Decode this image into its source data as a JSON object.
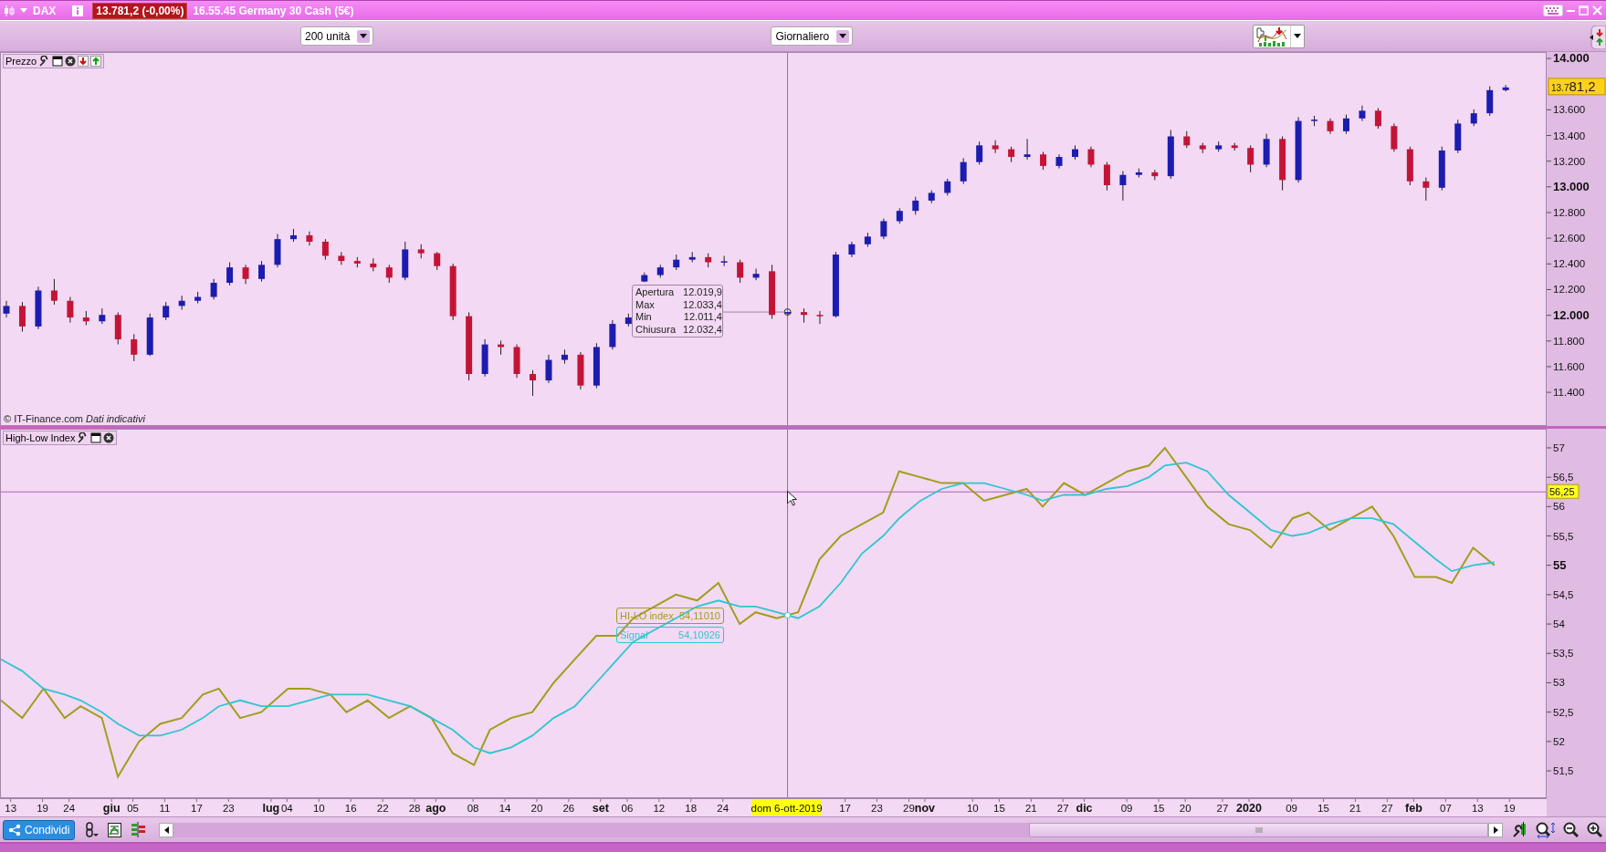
{
  "window": {
    "symbol": "DAX",
    "price": "13.781,2 (-0,00%)",
    "title": "16.55.45 Germany 30 Cash (5€)"
  },
  "toolbar": {
    "units": "200 unità",
    "period": "Giornaliero"
  },
  "price_pane": {
    "title": "Prezzo",
    "tooltip": [
      {
        "label": "Apertura",
        "value": "12.019,9"
      },
      {
        "label": "Max",
        "value": "12.033,4"
      },
      {
        "label": "Min",
        "value": "12.011,4"
      },
      {
        "label": "Chiusura",
        "value": "12.032,4"
      }
    ],
    "credit": "© IT-Finance.com *Dati indicativi*",
    "chart_data": {
      "type": "candlestick",
      "categories": [
        null,
        null,
        null,
        null,
        null,
        null,
        null,
        null,
        null,
        null,
        null,
        null,
        null,
        null,
        null,
        null,
        null,
        null,
        null,
        null,
        null,
        null,
        null,
        null,
        null,
        null,
        null,
        null,
        null,
        null,
        null,
        null,
        null,
        null,
        null,
        null,
        null,
        null,
        null,
        null,
        null,
        null,
        null,
        null,
        null,
        null,
        null,
        null,
        null,
        null,
        null,
        null,
        null,
        null,
        null,
        null,
        null,
        null,
        null,
        null,
        null,
        null,
        null,
        null,
        null,
        null,
        null,
        null,
        null,
        null,
        null,
        null,
        null,
        null,
        null,
        null,
        null,
        null,
        null,
        null,
        null,
        null,
        null,
        null,
        null,
        null,
        null,
        null,
        null,
        null,
        null,
        null,
        null,
        null,
        null
      ],
      "ohlc": [
        [
          12020,
          12120,
          11990,
          12080
        ],
        [
          12080,
          12110,
          11880,
          11920
        ],
        [
          11920,
          12230,
          11900,
          12200
        ],
        [
          12200,
          12290,
          12090,
          12120
        ],
        [
          12120,
          12150,
          11950,
          11990
        ],
        [
          11990,
          12040,
          11930,
          11960
        ],
        [
          11960,
          12060,
          11940,
          12010
        ],
        [
          12010,
          12030,
          11780,
          11820
        ],
        [
          11820,
          11860,
          11650,
          11700
        ],
        [
          11700,
          12020,
          11690,
          11990
        ],
        [
          11990,
          12110,
          11970,
          12080
        ],
        [
          12080,
          12160,
          12050,
          12120
        ],
        [
          12120,
          12190,
          12100,
          12150
        ],
        [
          12150,
          12290,
          12130,
          12260
        ],
        [
          12260,
          12420,
          12240,
          12380
        ],
        [
          12380,
          12400,
          12250,
          12290
        ],
        [
          12290,
          12430,
          12270,
          12400
        ],
        [
          12400,
          12640,
          12380,
          12600
        ],
        [
          12600,
          12680,
          12580,
          12630
        ],
        [
          12630,
          12660,
          12550,
          12580
        ],
        [
          12580,
          12600,
          12440,
          12470
        ],
        [
          12470,
          12500,
          12400,
          12430
        ],
        [
          12430,
          12460,
          12380,
          12410
        ],
        [
          12410,
          12450,
          12350,
          12380
        ],
        [
          12380,
          12400,
          12260,
          12300
        ],
        [
          12300,
          12580,
          12280,
          12520
        ],
        [
          12520,
          12560,
          12450,
          12490
        ],
        [
          12490,
          12500,
          12360,
          12390
        ],
        [
          12390,
          12410,
          11970,
          12000
        ],
        [
          12000,
          12030,
          11500,
          11550
        ],
        [
          11550,
          11820,
          11530,
          11780
        ],
        [
          11780,
          11810,
          11700,
          11760
        ],
        [
          11760,
          11780,
          11520,
          11550
        ],
        [
          11550,
          11580,
          11380,
          11500
        ],
        [
          11500,
          11700,
          11480,
          11660
        ],
        [
          11660,
          11740,
          11630,
          11700
        ],
        [
          11700,
          11720,
          11430,
          11460
        ],
        [
          11460,
          11790,
          11440,
          11760
        ],
        [
          11760,
          11970,
          11740,
          11940
        ],
        [
          11940,
          12020,
          11920,
          11990
        ],
        [
          12270,
          12340,
          12265,
          12320
        ],
        [
          12320,
          12400,
          12300,
          12380
        ],
        [
          12380,
          12480,
          12360,
          12440
        ],
        [
          12440,
          12500,
          12420,
          12460
        ],
        [
          12460,
          12490,
          12380,
          12420
        ],
        [
          12420,
          12470,
          12390,
          12425
        ],
        [
          12420,
          12440,
          12260,
          12300
        ],
        [
          12300,
          12370,
          12280,
          12330
        ],
        [
          12350,
          12400,
          11980,
          12010
        ],
        [
          12019.9,
          12033.4,
          12011.4,
          12032.4
        ],
        [
          12032,
          12060,
          11950,
          12010
        ],
        [
          12010,
          12040,
          11940,
          12000
        ],
        [
          12000,
          12500,
          11990,
          12480
        ],
        [
          12480,
          12580,
          12460,
          12560
        ],
        [
          12560,
          12650,
          12540,
          12620
        ],
        [
          12620,
          12760,
          12600,
          12740
        ],
        [
          12740,
          12840,
          12720,
          12820
        ],
        [
          12820,
          12930,
          12790,
          12900
        ],
        [
          12900,
          12980,
          12880,
          12960
        ],
        [
          12960,
          13070,
          12940,
          13050
        ],
        [
          13050,
          13230,
          13030,
          13200
        ],
        [
          13200,
          13360,
          13180,
          13330
        ],
        [
          13330,
          13370,
          13270,
          13300
        ],
        [
          13300,
          13320,
          13200,
          13240
        ],
        [
          13240,
          13380,
          13220,
          13260
        ],
        [
          13260,
          13280,
          13140,
          13170
        ],
        [
          13170,
          13260,
          13150,
          13240
        ],
        [
          13240,
          13330,
          13220,
          13300
        ],
        [
          13300,
          13320,
          13160,
          13180
        ],
        [
          13180,
          13200,
          12980,
          13020
        ],
        [
          13020,
          13130,
          12900,
          13100
        ],
        [
          13100,
          13150,
          13080,
          13120
        ],
        [
          13120,
          13140,
          13060,
          13090
        ],
        [
          13090,
          13450,
          13070,
          13400
        ],
        [
          13400,
          13440,
          13310,
          13330
        ],
        [
          13330,
          13350,
          13270,
          13300
        ],
        [
          13300,
          13360,
          13280,
          13330
        ],
        [
          13330,
          13350,
          13290,
          13310
        ],
        [
          13310,
          13330,
          13120,
          13180
        ],
        [
          13180,
          13420,
          13160,
          13380
        ],
        [
          13380,
          13400,
          12980,
          13060
        ],
        [
          13060,
          13550,
          13040,
          13520
        ],
        [
          13520,
          13560,
          13480,
          13530
        ],
        [
          13520,
          13540,
          13420,
          13440
        ],
        [
          13440,
          13570,
          13420,
          13540
        ],
        [
          13540,
          13640,
          13520,
          13600
        ],
        [
          13600,
          13620,
          13460,
          13480
        ],
        [
          13480,
          13500,
          13280,
          13300
        ],
        [
          13300,
          13320,
          13020,
          13050
        ],
        [
          13050,
          13080,
          12900,
          13000
        ],
        [
          13000,
          13320,
          12980,
          13290
        ],
        [
          13290,
          13530,
          13270,
          13500
        ],
        [
          13500,
          13610,
          13480,
          13580
        ],
        [
          13580,
          13790,
          13560,
          13760
        ],
        [
          13760,
          13800,
          13750,
          13781.2
        ]
      ],
      "ylim": [
        11138,
        14050
      ],
      "yticks": [
        {
          "value": 14000,
          "label": "14.000"
        },
        {
          "value": 13600,
          "label": "13.600"
        },
        {
          "value": 13400,
          "label": "13.400"
        },
        {
          "value": 13200,
          "label": "13.200"
        },
        {
          "value": 13000,
          "label": "13.000"
        },
        {
          "value": 12800,
          "label": "12.800"
        },
        {
          "value": 12600,
          "label": "12.600"
        },
        {
          "value": 12400,
          "label": "12.400"
        },
        {
          "value": 12200,
          "label": "12.200"
        },
        {
          "value": 12000,
          "label": "12.000"
        },
        {
          "value": 11800,
          "label": "11.800"
        },
        {
          "value": 11600,
          "label": "11.600"
        },
        {
          "value": 11400,
          "label": "11.400"
        }
      ],
      "annotations": [
        "13.781,2"
      ]
    }
  },
  "indicator_pane": {
    "title": "High-Low Index",
    "readouts": [
      "54,11010",
      "54,10926"
    ],
    "chart_data": {
      "type": "line",
      "x": [
        "2019-05-11",
        "2019-05-15",
        "2019-05-19",
        "2019-05-23",
        "2019-05-26",
        "2019-05-30",
        "2019-06-02",
        "2019-06-06",
        "2019-06-10",
        "2019-06-14",
        "2019-06-18",
        "2019-06-21",
        "2019-06-25",
        "2019-06-29",
        "2019-07-04",
        "2019-07-08",
        "2019-07-12",
        "2019-07-15",
        "2019-07-19",
        "2019-07-23",
        "2019-07-27",
        "2019-07-31",
        "2019-08-04",
        "2019-08-08",
        "2019-08-11",
        "2019-08-15",
        "2019-08-19",
        "2019-08-23",
        "2019-08-27",
        "2019-08-31",
        "2019-09-04",
        "2019-09-07",
        "2019-09-11",
        "2019-09-15",
        "2019-09-19",
        "2019-09-23",
        "2019-09-27",
        "2019-09-30",
        "2019-10-04",
        "2019-10-08",
        "2019-10-12",
        "2019-10-16",
        "2019-10-20",
        "2019-10-24",
        "2019-10-27",
        "2019-10-31",
        "2019-11-04",
        "2019-11-08",
        "2019-11-12",
        "2019-11-16",
        "2019-11-20",
        "2019-11-23",
        "2019-11-27",
        "2019-12-01",
        "2019-12-05",
        "2019-12-09",
        "2019-12-13",
        "2019-12-16",
        "2019-12-20",
        "2019-12-24",
        "2019-12-28",
        "2020-01-01",
        "2020-01-05",
        "2020-01-09",
        "2020-01-12",
        "2020-01-16",
        "2020-01-20",
        "2020-01-24",
        "2020-01-28",
        "2020-02-01",
        "2020-02-05",
        "2020-02-08",
        "2020-02-12",
        "2020-02-16"
      ],
      "series": [
        {
          "name": "HI-LO index",
          "color": "#a39c1c",
          "values": [
            52.7,
            52.4,
            52.9,
            52.4,
            52.6,
            52.4,
            51.4,
            52.0,
            52.3,
            52.4,
            52.8,
            52.9,
            52.4,
            52.5,
            52.9,
            52.9,
            52.8,
            52.5,
            52.7,
            52.4,
            52.6,
            52.4,
            51.8,
            51.6,
            52.2,
            52.4,
            52.5,
            53.0,
            53.4,
            53.8,
            53.8,
            54.1,
            54.3,
            54.5,
            54.4,
            54.7,
            54.0,
            54.2,
            54.1,
            54.2,
            55.1,
            55.5,
            55.7,
            55.9,
            56.6,
            56.5,
            56.4,
            56.4,
            56.1,
            56.2,
            56.3,
            56.0,
            56.4,
            56.2,
            56.4,
            56.6,
            56.7,
            57.0,
            56.5,
            56.0,
            55.7,
            55.6,
            55.3,
            55.8,
            55.9,
            55.6,
            55.8,
            56.0,
            55.5,
            54.8,
            54.8,
            54.7,
            55.3,
            55.0
          ]
        },
        {
          "name": "Signal",
          "color": "#2ec6d0",
          "values": [
            53.4,
            53.2,
            52.9,
            52.8,
            52.7,
            52.5,
            52.3,
            52.1,
            52.1,
            52.2,
            52.4,
            52.6,
            52.7,
            52.6,
            52.6,
            52.7,
            52.8,
            52.8,
            52.8,
            52.7,
            52.6,
            52.4,
            52.2,
            51.9,
            51.8,
            51.9,
            52.1,
            52.4,
            52.6,
            53.0,
            53.4,
            53.7,
            53.9,
            54.1,
            54.3,
            54.4,
            54.3,
            54.3,
            54.2,
            54.1,
            54.3,
            54.7,
            55.2,
            55.5,
            55.8,
            56.1,
            56.3,
            56.4,
            56.4,
            56.3,
            56.2,
            56.1,
            56.2,
            56.2,
            56.3,
            56.35,
            56.5,
            56.7,
            56.75,
            56.6,
            56.2,
            55.9,
            55.6,
            55.5,
            55.55,
            55.7,
            55.8,
            55.8,
            55.7,
            55.4,
            55.1,
            54.9,
            55.0,
            55.05
          ]
        }
      ],
      "xlim": [
        "2019-05-11",
        "2020-02-26"
      ],
      "ylim": [
        51.05,
        57.31
      ],
      "xticks": [
        {
          "value": "2019-05-13",
          "label": "13"
        },
        {
          "value": "2019-05-19",
          "label": "19"
        },
        {
          "value": "2019-05-24",
          "label": "24"
        },
        {
          "value": "2019-06-01",
          "label": "giu"
        },
        {
          "value": "2019-06-05",
          "label": "05"
        },
        {
          "value": "2019-06-11",
          "label": "11"
        },
        {
          "value": "2019-06-17",
          "label": "17"
        },
        {
          "value": "2019-06-23",
          "label": "23"
        },
        {
          "value": "2019-07-01",
          "label": "lug"
        },
        {
          "value": "2019-07-04",
          "label": "04"
        },
        {
          "value": "2019-07-10",
          "label": "10"
        },
        {
          "value": "2019-07-16",
          "label": "16"
        },
        {
          "value": "2019-07-22",
          "label": "22"
        },
        {
          "value": "2019-07-28",
          "label": "28"
        },
        {
          "value": "2019-08-01",
          "label": "ago"
        },
        {
          "value": "2019-08-08",
          "label": "08"
        },
        {
          "value": "2019-08-14",
          "label": "14"
        },
        {
          "value": "2019-08-20",
          "label": "20"
        },
        {
          "value": "2019-08-26",
          "label": "26"
        },
        {
          "value": "2019-09-01",
          "label": "set"
        },
        {
          "value": "2019-09-06",
          "label": "06"
        },
        {
          "value": "2019-09-12",
          "label": "12"
        },
        {
          "value": "2019-09-18",
          "label": "18"
        },
        {
          "value": "2019-09-24",
          "label": "24"
        },
        {
          "value": "2019-10-17",
          "label": "17"
        },
        {
          "value": "2019-10-23",
          "label": "23"
        },
        {
          "value": "2019-10-29",
          "label": "29"
        },
        {
          "value": "2019-11-01",
          "label": "nov"
        },
        {
          "value": "2019-11-10",
          "label": "10"
        },
        {
          "value": "2019-11-15",
          "label": "15"
        },
        {
          "value": "2019-11-21",
          "label": "21"
        },
        {
          "value": "2019-11-27",
          "label": "27"
        },
        {
          "value": "2019-12-01",
          "label": "dic"
        },
        {
          "value": "2019-12-09",
          "label": "09"
        },
        {
          "value": "2019-12-15",
          "label": "15"
        },
        {
          "value": "2019-12-20",
          "label": "20"
        },
        {
          "value": "2019-12-27",
          "label": "27"
        },
        {
          "value": "2020-01-01",
          "label": "2020"
        },
        {
          "value": "2020-01-09",
          "label": "09"
        },
        {
          "value": "2020-01-15",
          "label": "15"
        },
        {
          "value": "2020-01-21",
          "label": "21"
        },
        {
          "value": "2020-01-27",
          "label": "27"
        },
        {
          "value": "2020-02-01",
          "label": "feb"
        },
        {
          "value": "2020-02-07",
          "label": "07"
        },
        {
          "value": "2020-02-13",
          "label": "13"
        },
        {
          "value": "2020-02-19",
          "label": "19"
        }
      ],
      "yticks": [
        {
          "value": 57,
          "label": "57"
        },
        {
          "value": 56.5,
          "label": "56,5"
        },
        {
          "value": 56,
          "label": "56"
        },
        {
          "value": 55.5,
          "label": "55,5"
        },
        {
          "value": 55,
          "label": "55"
        },
        {
          "value": 54.5,
          "label": "54,5"
        },
        {
          "value": 54,
          "label": "54"
        },
        {
          "value": 53.5,
          "label": "53,5"
        },
        {
          "value": 53,
          "label": "53"
        },
        {
          "value": 52.5,
          "label": "52,5"
        },
        {
          "value": 52,
          "label": "52"
        },
        {
          "value": 51.5,
          "label": "51,5"
        }
      ],
      "ref_lines": [
        {
          "axis": "x",
          "value": "2019-10-06",
          "label": "dom 6-ott-2019"
        },
        {
          "axis": "y",
          "value": 56.25,
          "label": "56,25"
        }
      ]
    }
  },
  "bottom_bar": {
    "share_button": "Condividi"
  }
}
